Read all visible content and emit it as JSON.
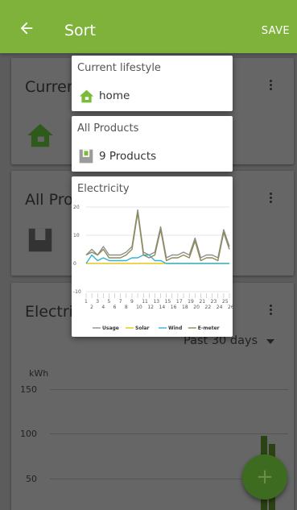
{
  "appbar": {
    "title": "Sort",
    "save_label": "SAVE",
    "back_icon": "arrow-left-icon"
  },
  "cards": [
    {
      "title": "Current lifestyle",
      "visible_title": "Curren",
      "icon": "home-icon"
    },
    {
      "title": "All Products",
      "visible_title": "All Pro",
      "icon": "product-box-icon"
    },
    {
      "title": "Electricity",
      "visible_title": "Electri",
      "period": "Past 30 days",
      "y_unit": "kWh",
      "y_ticks": [
        "150",
        "100",
        "50"
      ]
    }
  ],
  "drag_items": {
    "lifestyle": {
      "label": "Current lifestyle",
      "value": "home"
    },
    "products": {
      "label": "All Products",
      "value": "9 Products"
    },
    "electricity": {
      "label": "Electricity"
    }
  },
  "fab_label": "+",
  "colors": {
    "accent": "#7fb23a",
    "home": "#7cbb3a",
    "usage": "#8f8f8f",
    "solar": "#e8c51a",
    "wind": "#33b4d6",
    "emeter": "#8e8a5a"
  },
  "chart_data": {
    "type": "line",
    "x": [
      1,
      2,
      3,
      4,
      5,
      6,
      7,
      8,
      9,
      10,
      11,
      12,
      13,
      14,
      15,
      16,
      17,
      18,
      19,
      20,
      21,
      22,
      23,
      24,
      25,
      26
    ],
    "x_ticks_odd": [
      "1",
      "3",
      "5",
      "7",
      "9",
      "11",
      "13",
      "15",
      "17",
      "19",
      "21",
      "23",
      "25"
    ],
    "x_ticks_even": [
      "2",
      "4",
      "6",
      "8",
      "10",
      "12",
      "14",
      "16",
      "18",
      "20",
      "22",
      "24",
      "26"
    ],
    "y_ticks": [
      "20",
      "10",
      "0",
      "-10"
    ],
    "ylim": [
      -10,
      20
    ],
    "series": [
      {
        "name": "Usage",
        "color": "#8f8f8f",
        "values": [
          3,
          5,
          3,
          6,
          3,
          3,
          3,
          4,
          6,
          19,
          4,
          3,
          4,
          13,
          2,
          3,
          3,
          4,
          3,
          9,
          2,
          3,
          3,
          2,
          12,
          6
        ]
      },
      {
        "name": "Solar",
        "color": "#e8c51a",
        "values": [
          0,
          0,
          0,
          0,
          0,
          0,
          0,
          0,
          0,
          0,
          0,
          0,
          0,
          0,
          0,
          0,
          0,
          0,
          0,
          0,
          0,
          0,
          0,
          0,
          0,
          0
        ]
      },
      {
        "name": "Wind",
        "color": "#33b4d6",
        "values": [
          0,
          3,
          1,
          2,
          1,
          1,
          1,
          1,
          2,
          2,
          3,
          3,
          1,
          1,
          0,
          0,
          0,
          0,
          0,
          0,
          0,
          0,
          0,
          0,
          0,
          0
        ]
      },
      {
        "name": "E-meter",
        "color": "#8e8a5a",
        "values": [
          3,
          4,
          3,
          5,
          2,
          2,
          2,
          3,
          5,
          18,
          3,
          2,
          3,
          12,
          1,
          2,
          2,
          3,
          2,
          8,
          1,
          2,
          2,
          1,
          11,
          5
        ]
      }
    ]
  }
}
